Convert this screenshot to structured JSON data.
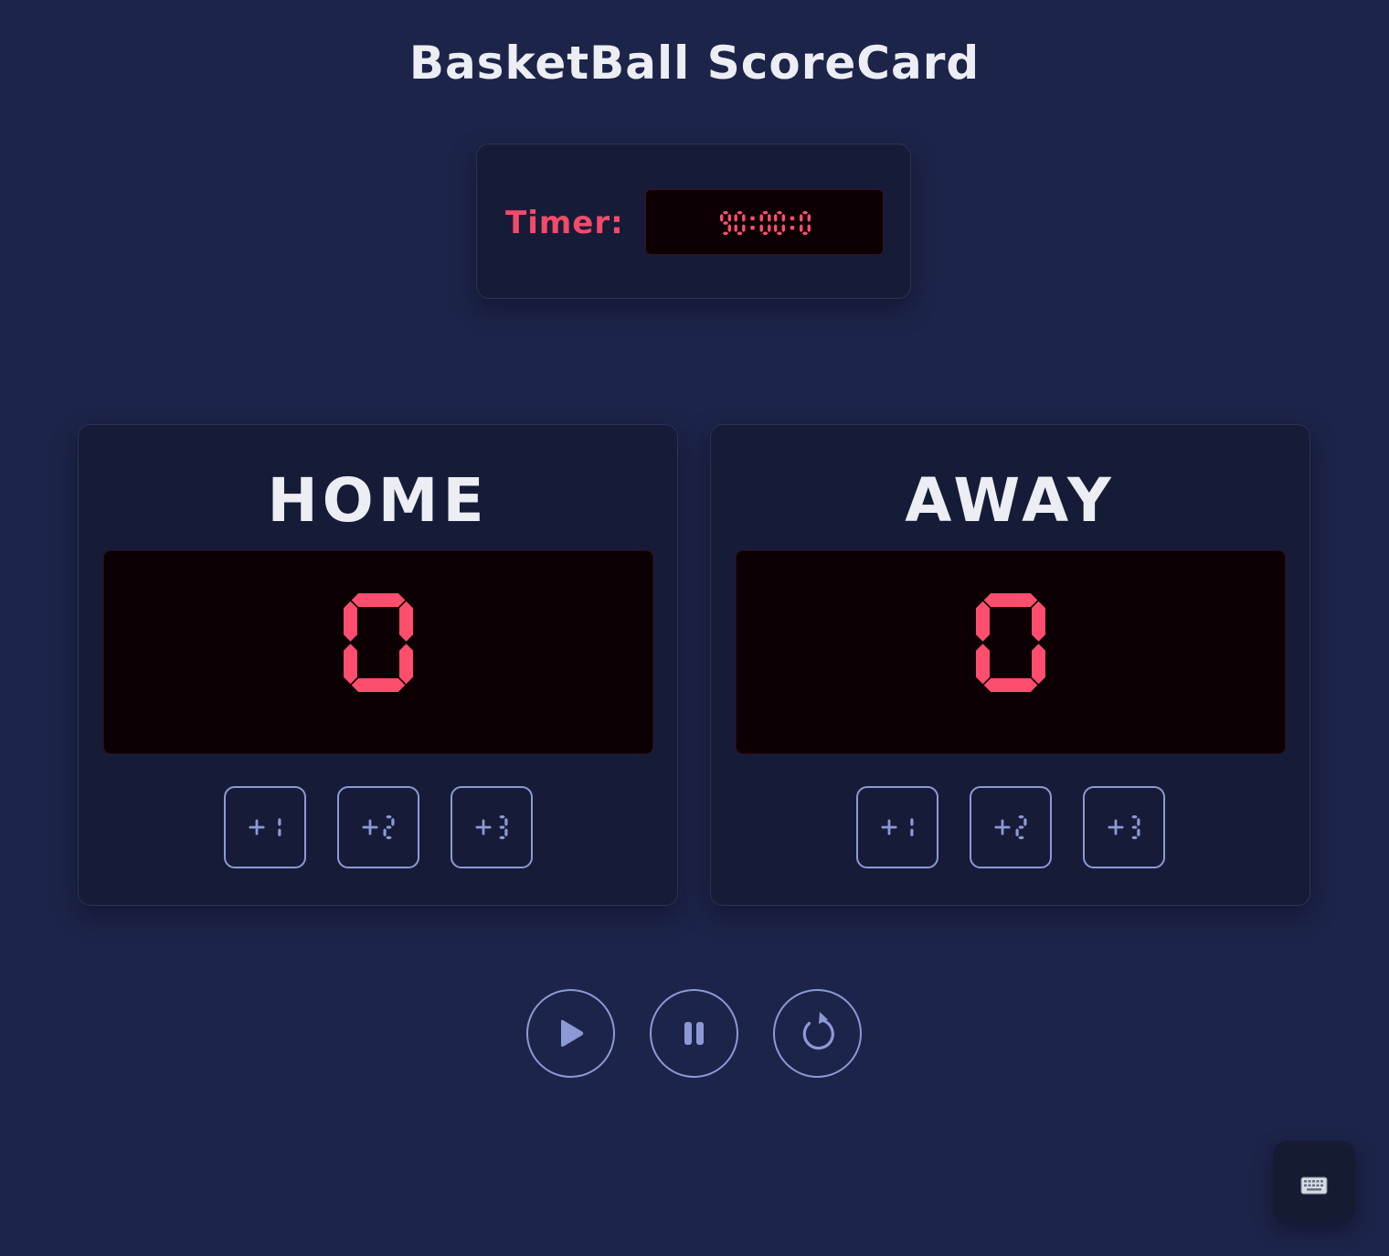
{
  "title": "BasketBall ScoreCard",
  "timer": {
    "label": "Timer:",
    "value": "90:00:0"
  },
  "teams": [
    {
      "name": "HOME",
      "score": "0",
      "buttons": [
        "+1",
        "+2",
        "+3"
      ]
    },
    {
      "name": "AWAY",
      "score": "0",
      "buttons": [
        "+1",
        "+2",
        "+3"
      ]
    }
  ],
  "controls": {
    "start_icon": "play-icon",
    "pause_icon": "pause-icon",
    "reset_icon": "reset-icon"
  },
  "keyboard_icon": "keyboard-icon",
  "colors": {
    "background": "#1c2449",
    "card": "#161c38",
    "led_red": "#ff4d6d",
    "accent_blue": "#8d99d6",
    "text_white": "#eceef4"
  }
}
